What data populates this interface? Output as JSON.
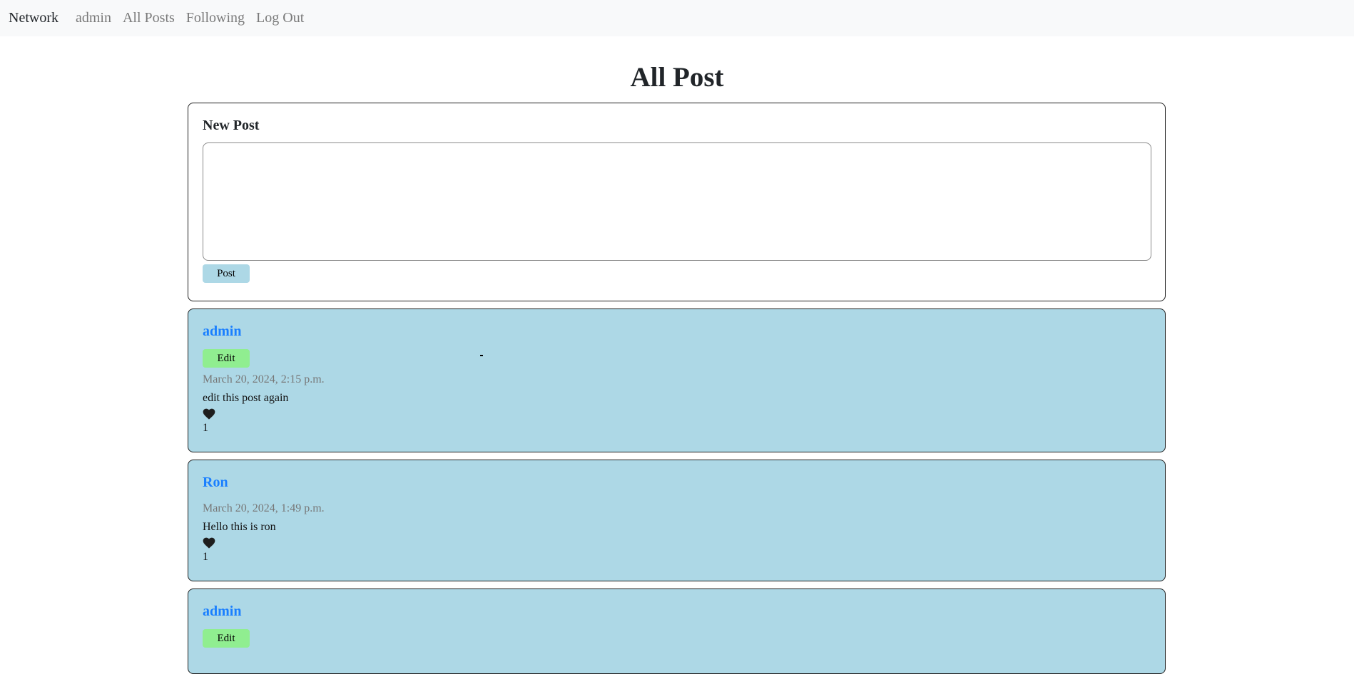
{
  "nav": {
    "brand": "Network",
    "links": [
      "admin",
      "All Posts",
      "Following",
      "Log Out"
    ]
  },
  "page": {
    "title": "All Post"
  },
  "new_post": {
    "title": "New Post",
    "textarea_value": "",
    "button_label": "Post"
  },
  "posts": [
    {
      "author": "admin",
      "edit_label": "Edit",
      "timestamp": "March 20, 2024, 2:15 p.m.",
      "content": "edit this post again",
      "like_icon": "heart-icon",
      "likes": "1"
    },
    {
      "author": "Ron",
      "timestamp": "March 20, 2024, 1:49 p.m.",
      "content": "Hello this is ron",
      "like_icon": "heart-icon",
      "likes": "1"
    },
    {
      "author": "admin",
      "edit_label": "Edit"
    }
  ],
  "colors": {
    "navbar_bg": "#f8f9fa",
    "post_bg": "#add8e6",
    "edit_button": "#90ee90",
    "post_button": "#add8e6",
    "author_link": "#1a7fff"
  }
}
